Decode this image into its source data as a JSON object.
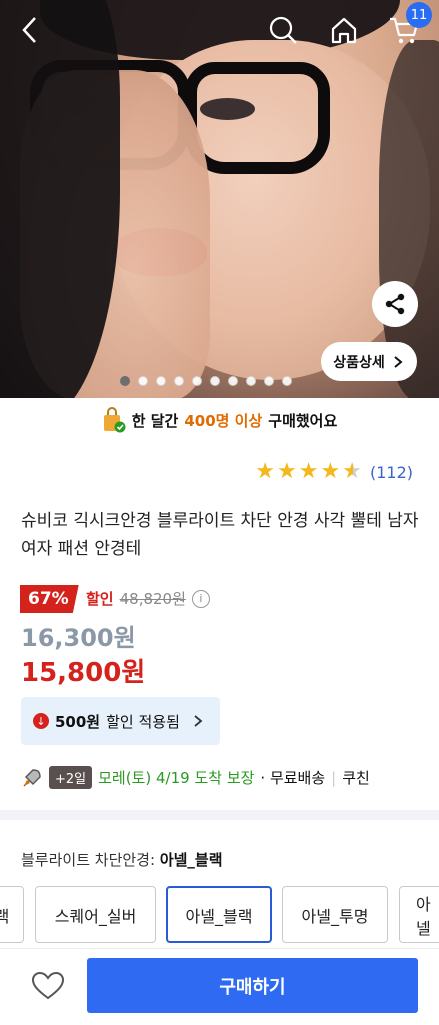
{
  "header": {
    "cart_count": "11"
  },
  "hero": {
    "detail_label": "상품상세",
    "slide_count": 10,
    "active_slide": 1
  },
  "social_proof": {
    "prefix": "한 달간",
    "highlight": "400명 이상",
    "suffix": "구매했어요"
  },
  "rating": {
    "stars": 4.5,
    "review_count": "(112)"
  },
  "product": {
    "title": "슈비코 긱시크안경 블루라이트 차단 안경 사각 뿔테 남자 여자 패션 안경테"
  },
  "pricing": {
    "discount_percent": "67%",
    "discount_label": "할인",
    "original_price": "48,820원",
    "sale_price": "16,300원",
    "final_price": "15,800원",
    "coupon_amount": "500원",
    "coupon_text": "할인 적용됨"
  },
  "delivery": {
    "badge": "+2일",
    "date_text": "모레(토) 4/19 도착 보장",
    "shipping": "· 무료배송",
    "divider": "|",
    "extra": "쿠친"
  },
  "options": {
    "label": "블루라이트 차단안경:",
    "selected": "아넬_블랙",
    "items": [
      "랙",
      "스퀘어_실버",
      "아넬_블랙",
      "아넬_투명",
      "아넬"
    ]
  },
  "actions": {
    "buy_label": "구매하기"
  },
  "colors": {
    "accent": "#2f6bf2",
    "discount": "#d4221c",
    "highlight": "#e06b00",
    "delivery": "#2a9a22"
  }
}
